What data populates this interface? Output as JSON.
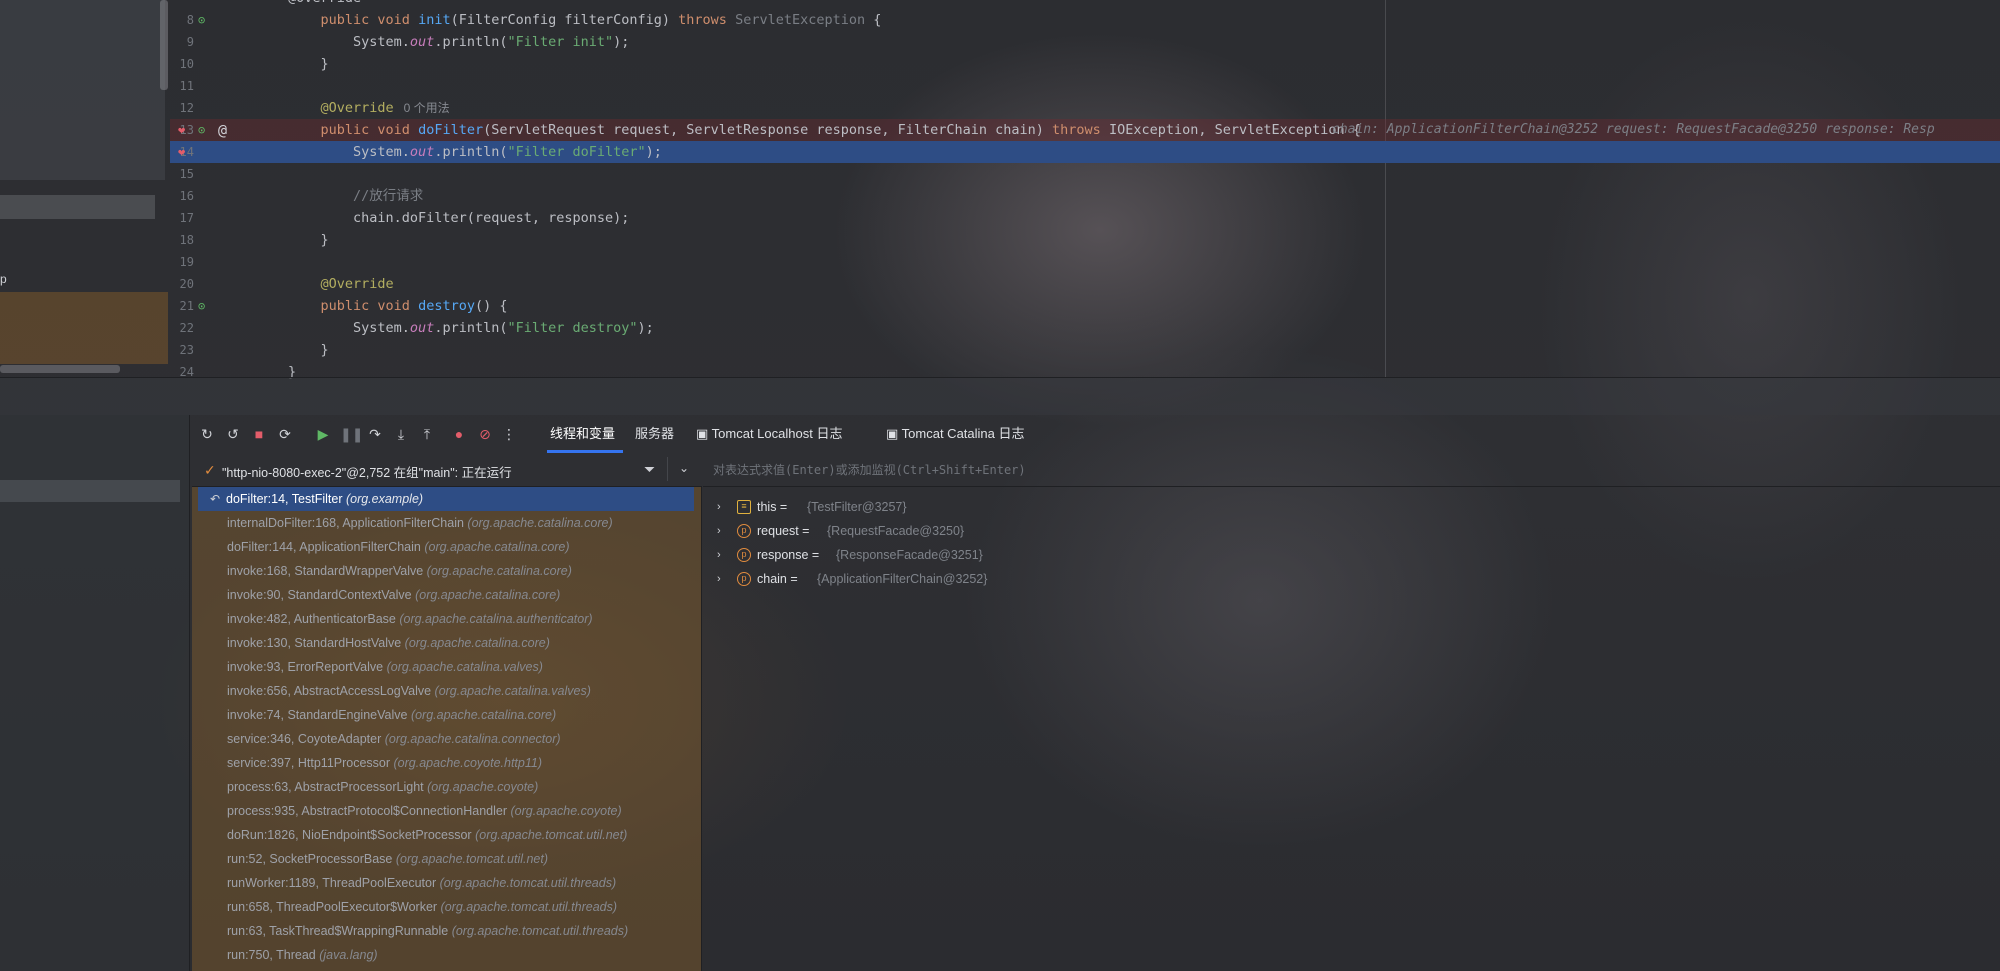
{
  "colors": {
    "accent": "#3574f0",
    "highlight": "#2e4d85",
    "breakpoint": "#e35d6a",
    "keyword": "#cf8e6d",
    "string": "#6aab73",
    "function": "#56a8f5",
    "annotation": "#b3ae60"
  },
  "left_strip": {
    "fragment": "p"
  },
  "editor": {
    "lines": [
      {
        "n": "8",
        "code_html": "    <span class=\"k\">public void</span> <span class=\"fn\">init</span>(FilterConfig filterConfig) <span class=\"k\">throws</span> <span class=\"g\">ServletException</span> {"
      },
      {
        "n": "9",
        "code_html": "        System.<span class=\"st\">out</span>.println(<span class=\"s\">\"Filter init\"</span>);"
      },
      {
        "n": "10",
        "code_html": "    }"
      },
      {
        "n": "11",
        "code_html": ""
      },
      {
        "n": "12",
        "code_html": "    <span class=\"a\">@Override</span>"
      },
      {
        "n": "13",
        "code_html": "    <span class=\"k\">public void</span> <span class=\"fn\">doFilter</span>(ServletRequest request, ServletResponse response, FilterChain chain) <span class=\"k\">throws</span> IOException, ServletException {"
      },
      {
        "n": "14",
        "code_html": "        System.<span class=\"st\">out</span>.println(<span class=\"s\">\"Filter doFilter\"</span>);"
      },
      {
        "n": "15",
        "code_html": ""
      },
      {
        "n": "16",
        "code_html": "        <span class=\"cm\">//放行请求</span>"
      },
      {
        "n": "17",
        "code_html": "        chain.doFilter(request, response);"
      },
      {
        "n": "18",
        "code_html": "    }"
      },
      {
        "n": "19",
        "code_html": ""
      },
      {
        "n": "20",
        "code_html": "    <span class=\"a\">@Override</span>"
      },
      {
        "n": "21",
        "code_html": "    <span class=\"k\">public void</span> <span class=\"fn\">destroy</span>() {"
      },
      {
        "n": "22",
        "code_html": "        System.<span class=\"st\">out</span>.println(<span class=\"s\">\"Filter destroy\"</span>);"
      },
      {
        "n": "23",
        "code_html": "    }"
      },
      {
        "n": "24",
        "code_html": "}"
      }
    ],
    "top_partial": "@Override",
    "usages_label": "0 个用法",
    "inline_hint": "chain: ApplicationFilterChain@3252    request: RequestFacade@3250    response: Resp"
  },
  "debug": {
    "tabs": [
      "线程和变量",
      "服务器",
      "Tomcat Localhost 日志",
      "Tomcat Catalina 日志"
    ],
    "thread": "\"http-nio-8080-exec-2\"@2,752 在组\"main\": 正在运行",
    "eval_placeholder": "对表达式求值(Enter)或添加监视(Ctrl+Shift+Enter)",
    "frames": [
      {
        "method": "doFilter:14, TestFilter",
        "pkg": "(org.example)"
      },
      {
        "method": "internalDoFilter:168, ApplicationFilterChain",
        "pkg": "(org.apache.catalina.core)"
      },
      {
        "method": "doFilter:144, ApplicationFilterChain",
        "pkg": "(org.apache.catalina.core)"
      },
      {
        "method": "invoke:168, StandardWrapperValve",
        "pkg": "(org.apache.catalina.core)"
      },
      {
        "method": "invoke:90, StandardContextValve",
        "pkg": "(org.apache.catalina.core)"
      },
      {
        "method": "invoke:482, AuthenticatorBase",
        "pkg": "(org.apache.catalina.authenticator)"
      },
      {
        "method": "invoke:130, StandardHostValve",
        "pkg": "(org.apache.catalina.core)"
      },
      {
        "method": "invoke:93, ErrorReportValve",
        "pkg": "(org.apache.catalina.valves)"
      },
      {
        "method": "invoke:656, AbstractAccessLogValve",
        "pkg": "(org.apache.catalina.valves)"
      },
      {
        "method": "invoke:74, StandardEngineValve",
        "pkg": "(org.apache.catalina.core)"
      },
      {
        "method": "service:346, CoyoteAdapter",
        "pkg": "(org.apache.catalina.connector)"
      },
      {
        "method": "service:397, Http11Processor",
        "pkg": "(org.apache.coyote.http11)"
      },
      {
        "method": "process:63, AbstractProcessorLight",
        "pkg": "(org.apache.coyote)"
      },
      {
        "method": "process:935, AbstractProtocol$ConnectionHandler",
        "pkg": "(org.apache.coyote)"
      },
      {
        "method": "doRun:1826, NioEndpoint$SocketProcessor",
        "pkg": "(org.apache.tomcat.util.net)"
      },
      {
        "method": "run:52, SocketProcessorBase",
        "pkg": "(org.apache.tomcat.util.net)"
      },
      {
        "method": "runWorker:1189, ThreadPoolExecutor",
        "pkg": "(org.apache.tomcat.util.threads)"
      },
      {
        "method": "run:658, ThreadPoolExecutor$Worker",
        "pkg": "(org.apache.tomcat.util.threads)"
      },
      {
        "method": "run:63, TaskThread$WrappingRunnable",
        "pkg": "(org.apache.tomcat.util.threads)"
      },
      {
        "method": "run:750, Thread",
        "pkg": "(java.lang)"
      }
    ],
    "variables": [
      {
        "name": "this",
        "value": "{TestFilter@3257}",
        "icon": "stack-icon"
      },
      {
        "name": "request",
        "value": "{RequestFacade@3250}",
        "icon": "param-icon"
      },
      {
        "name": "response",
        "value": "{ResponseFacade@3251}",
        "icon": "param-icon"
      },
      {
        "name": "chain",
        "value": "{ApplicationFilterChain@3252}",
        "icon": "param-icon"
      }
    ]
  }
}
